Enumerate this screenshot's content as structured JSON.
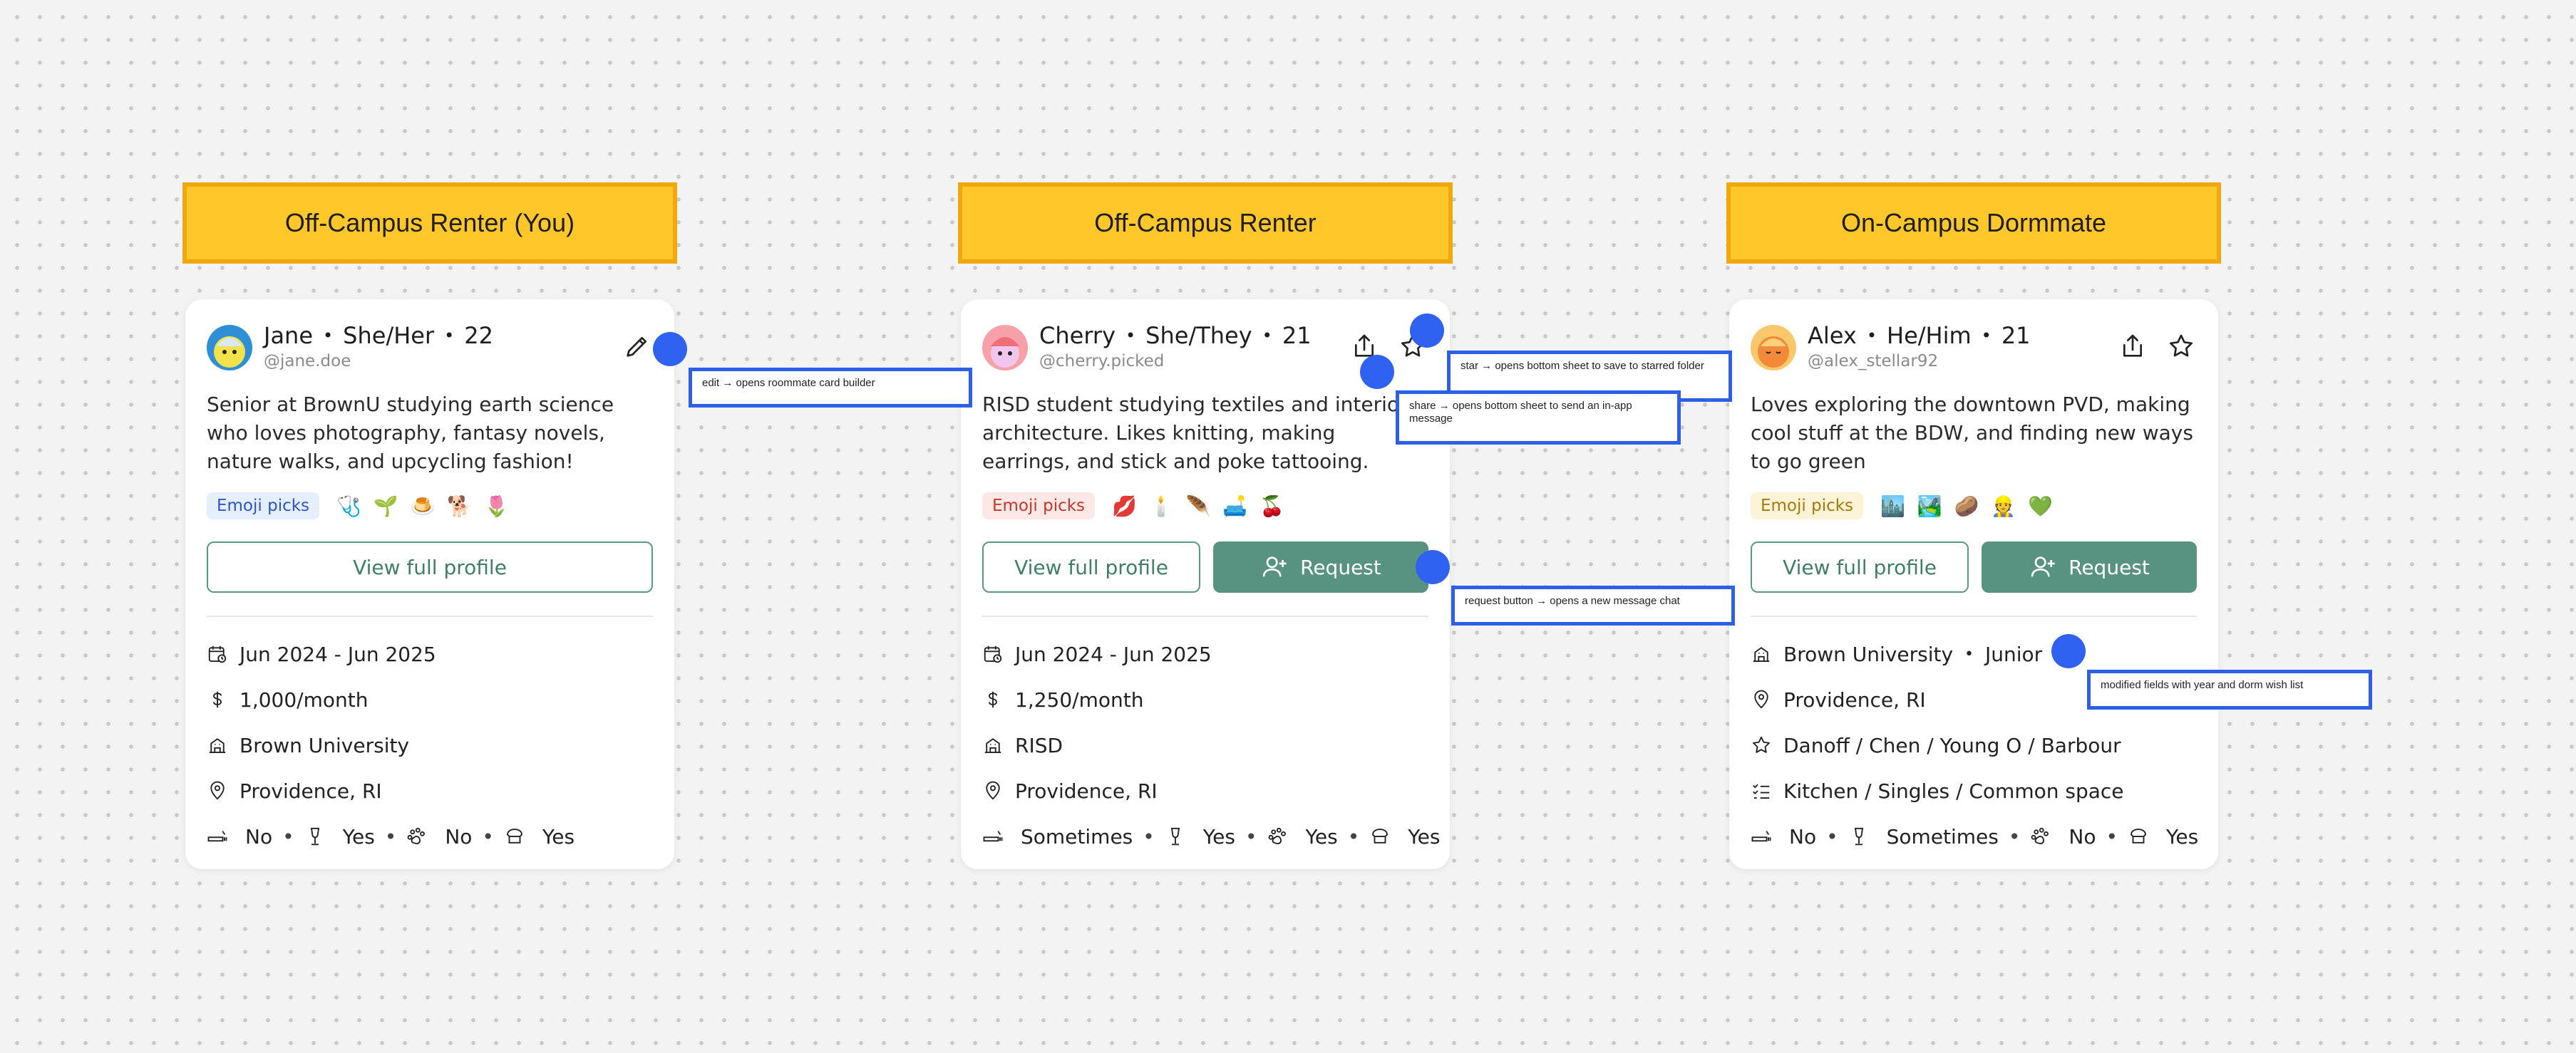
{
  "labels": [
    "Off-Campus Renter (You)",
    "Off-Campus Renter",
    "On-Campus Dormmate"
  ],
  "cards": [
    {
      "name": "Jane",
      "pronouns": "She/Her",
      "age": "22",
      "handle": "@jane.doe",
      "bio": "Senior at BrownU studying earth science who loves photography, fantasy novels, nature walks, and upcycling fashion!",
      "emoji_label": "Emoji picks",
      "emoji_tag_color": "#e6efff",
      "emoji_tag_text": "#2b55c9",
      "emojis": "🩺 🌱 🍮 🐕 🌷",
      "view_button": "View full profile",
      "date": "Jun 2024 - Jun 2025",
      "price": "1,000/month",
      "school": "Brown University",
      "location": "Providence, RI",
      "smoking": "No",
      "drinking": "Yes",
      "pets": "No",
      "hat": "Yes",
      "avatar_colors": [
        "#2f8fd6",
        "#f2e24a"
      ]
    },
    {
      "name": "Cherry",
      "pronouns": "She/They",
      "age": "21",
      "handle": "@cherry.picked",
      "bio": "RISD student studying textiles and interior architecture. Likes knitting, making earrings, and stick and poke tattooing.",
      "emoji_label": "Emoji picks",
      "emoji_tag_color": "#fde8e6",
      "emoji_tag_text": "#c9352a",
      "emojis": "💋 🕯️ 🪶 🛋️ 🍒",
      "view_button": "View full profile",
      "request_button": "Request",
      "date": "Jun 2024 - Jun 2025",
      "price": "1,250/month",
      "school": "RISD",
      "location": "Providence, RI",
      "smoking": "Sometimes",
      "drinking": "Yes",
      "pets": "Yes",
      "hat": "Yes",
      "avatar_colors": [
        "#f7a0a8",
        "#f0f0f0"
      ]
    },
    {
      "name": "Alex",
      "pronouns": "He/Him",
      "age": "21",
      "handle": "@alex_stellar92",
      "bio": "Loves exploring the downtown PVD, making cool stuff at the BDW, and finding new ways to go green",
      "emoji_label": "Emoji picks",
      "emoji_tag_color": "#fdf3d6",
      "emoji_tag_text": "#a7780a",
      "emojis": "🏙️ 🏞️ 🥔 👷 💚",
      "view_button": "View full profile",
      "request_button": "Request",
      "school": "Brown University",
      "year": "Junior",
      "location": "Providence, RI",
      "dorms": "Danoff / Chen / Young O / Barbour",
      "wishlist": "Kitchen / Singles / Common space",
      "smoking": "No",
      "drinking": "Sometimes",
      "pets": "No",
      "hat": "Yes",
      "avatar_colors": [
        "#f38a3a",
        "#f9c86b"
      ]
    }
  ],
  "annotations": {
    "edit": "edit → opens roommate card builder",
    "star": "star → opens bottom sheet to save to starred folder",
    "share": "share → opens bottom sheet to send an in-app message",
    "request": "request button → opens a new message chat",
    "modified": "modified fields with year and dorm wish list"
  },
  "colors": {
    "accent": "#579380",
    "label_fill": "#ffc72a",
    "annotation_blue": "#3062f2"
  }
}
